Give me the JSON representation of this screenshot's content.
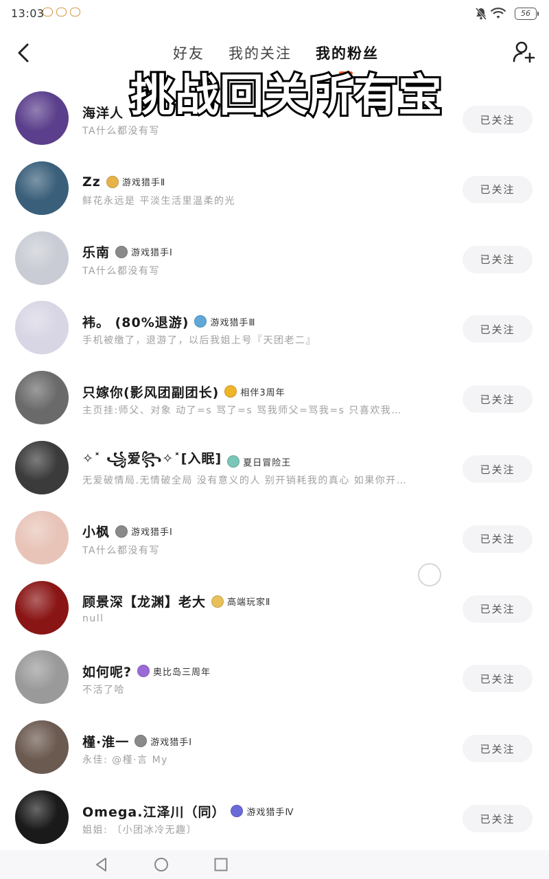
{
  "status_bar": {
    "time": "13:03",
    "battery": "56"
  },
  "nav": {
    "tabs": [
      "好友",
      "我的关注",
      "我的粉丝"
    ],
    "active_tab": 2
  },
  "overlay_caption": "挑战回关所有宝",
  "follow_label": "已关注",
  "colors": {
    "accent": "#ff5a1f",
    "button_bg": "#f4f4f6",
    "bio": "#a0a0a0"
  },
  "fans": [
    {
      "name": "海洋人",
      "badge": "",
      "badge_color": "",
      "bio": "TA什么都没有写",
      "avatar_color": "#5b3f8c"
    },
    {
      "name": "Zz",
      "badge": "游戏猎手Ⅱ",
      "badge_color": "#e6b34a",
      "bio": "鲜花永远是 平淡生活里温柔的光",
      "avatar_color": "#3a5f7a"
    },
    {
      "name": "乐南",
      "badge": "游戏猎手Ⅰ",
      "badge_color": "#8a8a8a",
      "bio": "TA什么都没有写",
      "avatar_color": "#c9ccd4"
    },
    {
      "name": "袆。 (80%退游)",
      "badge": "游戏猎手Ⅲ",
      "badge_color": "#5fa8d8",
      "bio": "手机被缴了，退游了，以后我姐上号『天团老二』",
      "avatar_color": "#d8d6e4"
    },
    {
      "name": "只嫁你(影风团副团长)",
      "badge": "相伴3周年",
      "badge_color": "#f0b429",
      "bio": "主页挂:师父、对象 动了=s 骂了=s 骂我师父=骂我=s 只喜欢我…",
      "avatar_color": "#6a6a6a"
    },
    {
      "name": "✧˟ ꧁爱꧂✧˟[入眠]",
      "badge": "夏日冒险王",
      "badge_color": "#7ac6b8",
      "bio": "无爱破情局.无情破全局 没有意义的人 别开销耗我的真心 如果你开…",
      "avatar_color": "#3b3b3b"
    },
    {
      "name": "小枫",
      "badge": "游戏猎手Ⅰ",
      "badge_color": "#8a8a8a",
      "bio": "TA什么都没有写",
      "avatar_color": "#e8c4b8"
    },
    {
      "name": "顾景深【龙渊】老大",
      "badge": "高端玩家Ⅱ",
      "badge_color": "#e8c05a",
      "bio": "null",
      "avatar_color": "#8a1515"
    },
    {
      "name": "如何呢?",
      "badge": "奥比岛三周年",
      "badge_color": "#9a6ad8",
      "bio": "不活了哈",
      "avatar_color": "#9a9a9a"
    },
    {
      "name": "槿·淮一",
      "badge": "游戏猎手Ⅰ",
      "badge_color": "#8a8a8a",
      "bio": "永佳: @槿·言  My",
      "avatar_color": "#6b5a50"
    },
    {
      "name": "Omega.江泽川（同）",
      "badge": "游戏猎手Ⅳ",
      "badge_color": "#6a6ad8",
      "bio": "姐姐: 〔小团冰冷无趣〕",
      "avatar_color": "#1a1a1a"
    }
  ]
}
